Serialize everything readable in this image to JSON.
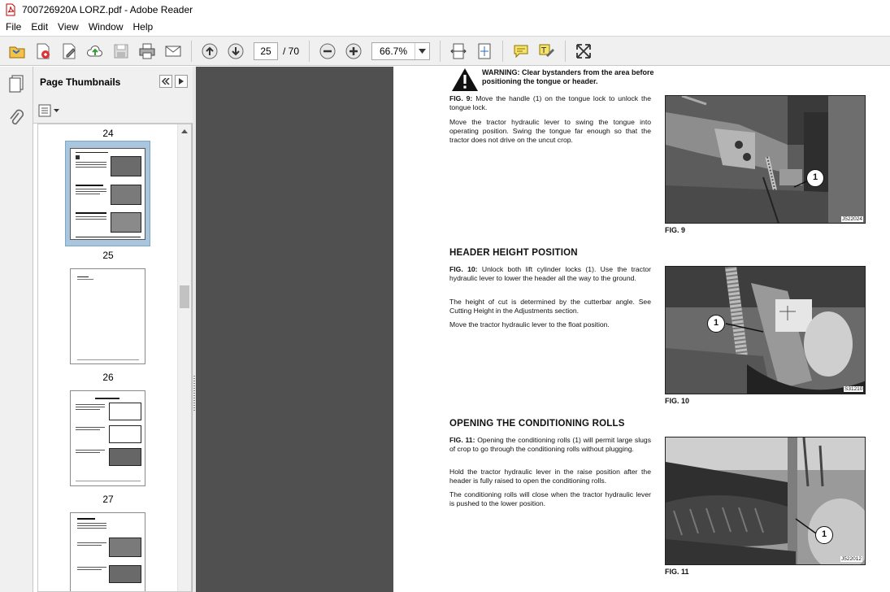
{
  "window": {
    "title": "700726920A LORZ.pdf - Adobe Reader"
  },
  "menu": [
    "File",
    "Edit",
    "View",
    "Window",
    "Help"
  ],
  "toolbar": {
    "current_page": "25",
    "page_total": "/ 70",
    "zoom": "66.7%"
  },
  "thumbnails": {
    "title": "Page Thumbnails",
    "labels": [
      "24",
      "25",
      "26",
      "27"
    ]
  },
  "page": {
    "warning": "WARNING: Clear bystanders from the area before positioning the tongue or header.",
    "fig9_ref": "FIG. 9:",
    "fig9_p1": " Move the handle (1) on the tongue lock to unlock the tongue lock.",
    "fig9_p2": "Move the tractor hydraulic lever to swing the tongue into operating position. Swing the tongue far enough so that the tractor does not drive on the uncut crop.",
    "heading1": "HEADER HEIGHT POSITION",
    "fig10_ref": "FIG. 10:",
    "fig10_p1": " Unlock both lift cylinder locks (1). Use the tractor hydraulic lever to lower the header all the way to the ground.",
    "fig10_p2": "The height of cut is determined by the cutterbar angle. See Cutting Height in the Adjustments section.",
    "fig10_p3": "Move the tractor hydraulic lever to the float position.",
    "heading2": "OPENING THE CONDITIONING ROLLS",
    "fig11_ref": "FIG. 11:",
    "fig11_p1": " Opening the conditioning rolls (1) will permit large slugs of crop to go through the conditioning rolls without plugging.",
    "fig11_p2": "Hold the tractor hydraulic lever in the raise position after the header is fully raised to open the conditioning rolls.",
    "fig11_p3": "The conditioning rolls will close when the tractor hydraulic lever is pushed to the lower position.",
    "fig9_caption": "FIG. 9",
    "fig10_caption": "FIG. 10",
    "fig11_caption": "FIG. 11",
    "fig9_code": "J522024",
    "fig10_code": "S31210",
    "fig11_code": "J522012",
    "callout": "1"
  }
}
